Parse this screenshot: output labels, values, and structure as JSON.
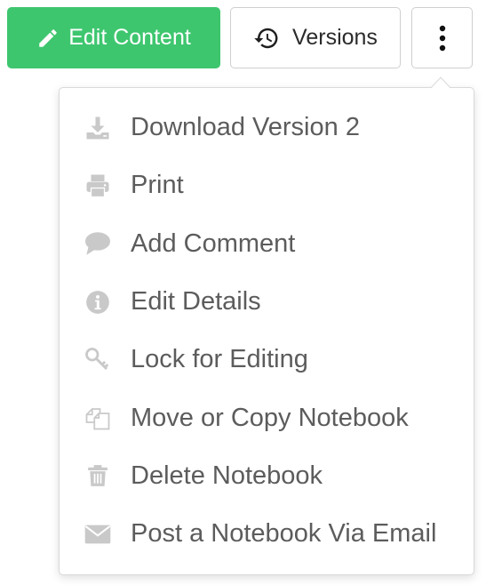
{
  "toolbar": {
    "edit_label": "Edit Content",
    "edit_icon": "pencil-icon",
    "versions_label": "Versions",
    "versions_icon": "history-icon",
    "more_icon": "vertical-ellipsis-icon"
  },
  "colors": {
    "accent_green": "#3ec66f",
    "menu_icon_gray": "#c9c9c9",
    "menu_text": "#5c5c5c"
  },
  "menu": {
    "items": [
      {
        "label": "Download Version 2",
        "icon": "download-icon"
      },
      {
        "label": "Print",
        "icon": "printer-icon"
      },
      {
        "label": "Add Comment",
        "icon": "comment-icon"
      },
      {
        "label": "Edit Details",
        "icon": "info-icon"
      },
      {
        "label": "Lock for Editing",
        "icon": "key-icon"
      },
      {
        "label": "Move or Copy Notebook",
        "icon": "copy-icon"
      },
      {
        "label": "Delete Notebook",
        "icon": "trash-icon"
      },
      {
        "label": "Post a Notebook Via Email",
        "icon": "envelope-icon"
      }
    ]
  }
}
